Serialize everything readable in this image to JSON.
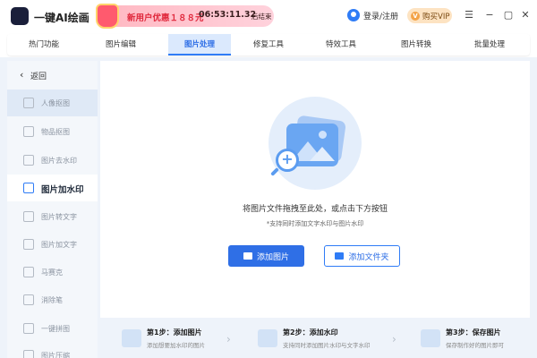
{
  "app": {
    "name": "一键AI绘画"
  },
  "promo": {
    "text": "新用户优惠１８８元",
    "time": "06:53:11.32",
    "suffix": "后结束"
  },
  "header": {
    "user_label": "登录/注册",
    "vip_label": "购买VIP"
  },
  "window_controls": [
    "menu-icon",
    "minimize-icon",
    "maximize-icon",
    "close-icon"
  ],
  "tabs": [
    {
      "label": "热门功能"
    },
    {
      "label": "图片编辑"
    },
    {
      "label": "图片处理"
    },
    {
      "label": "修复工具"
    },
    {
      "label": "特效工具"
    },
    {
      "label": "图片转换"
    },
    {
      "label": "批量处理"
    }
  ],
  "active_tab": "图片处理",
  "sidebar": {
    "back_label": "返回",
    "items": [
      {
        "label": "人像抠图",
        "icon": "portrait-icon"
      },
      {
        "label": "物品抠图",
        "icon": "object-icon"
      },
      {
        "label": "图片去水印",
        "icon": "eraser-icon"
      },
      {
        "label": "图片加水印",
        "icon": "watermark-icon"
      },
      {
        "label": "图片转文字",
        "icon": "ocr-icon"
      },
      {
        "label": "图片加文字",
        "icon": "text-icon"
      },
      {
        "label": "马赛克",
        "icon": "mosaic-icon"
      },
      {
        "label": "消除笔",
        "icon": "pen-icon"
      },
      {
        "label": "一键拼图",
        "icon": "collage-icon"
      },
      {
        "label": "图片压缩",
        "icon": "compress-icon"
      }
    ]
  },
  "main": {
    "hint": "将图片文件拖拽至此处，或点击下方按钮",
    "subhint": "*支持同时添加文字水印与图片水印",
    "add_image": "添加图片",
    "add_folder": "添加文件夹"
  },
  "steps": [
    {
      "title": "第1步：添加图片",
      "desc": "添加想要加水印的图片"
    },
    {
      "title": "第2步：添加水印",
      "desc": "支持同时添加图片水印与文字水印"
    },
    {
      "title": "第3步：保存图片",
      "desc": "保存制作好的图片即可"
    }
  ],
  "colors": {
    "accent": "#2f6fe6",
    "active_tab_bg": "#dbe9fd",
    "promo": "#e0283c",
    "vip": "#fde3c2"
  }
}
